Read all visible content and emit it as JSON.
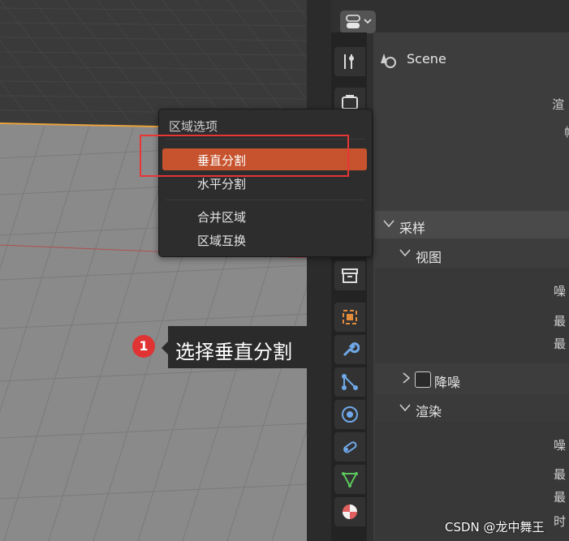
{
  "header": {
    "scene_label": "Scene"
  },
  "context_menu": {
    "title": "区域选项",
    "items": [
      "垂直分割",
      "水平分割",
      "合并区域",
      "区域互换"
    ],
    "highlight_color": "#c6532e"
  },
  "annotation": {
    "badge": "1",
    "text": "选择垂直分割",
    "badge_color": "#e03333",
    "box_color": "#e83535"
  },
  "properties": {
    "sampling_header": "采样",
    "viewport_header": "视图",
    "denoise_label": "降噪",
    "render_header": "渲染",
    "cut_labels": [
      "渲",
      "帧",
      "噪",
      "最",
      "最",
      "噪",
      "最",
      "最",
      "时"
    ]
  },
  "watermark": "CSDN @龙中舞王",
  "icons": [
    "editor-type-icon",
    "tool-icon",
    "render-icon",
    "scene-icon",
    "collection-icon",
    "object-icon",
    "modifier-icon",
    "particles-icon",
    "physics-icon",
    "constraints-icon",
    "data-icon",
    "material-icon"
  ]
}
